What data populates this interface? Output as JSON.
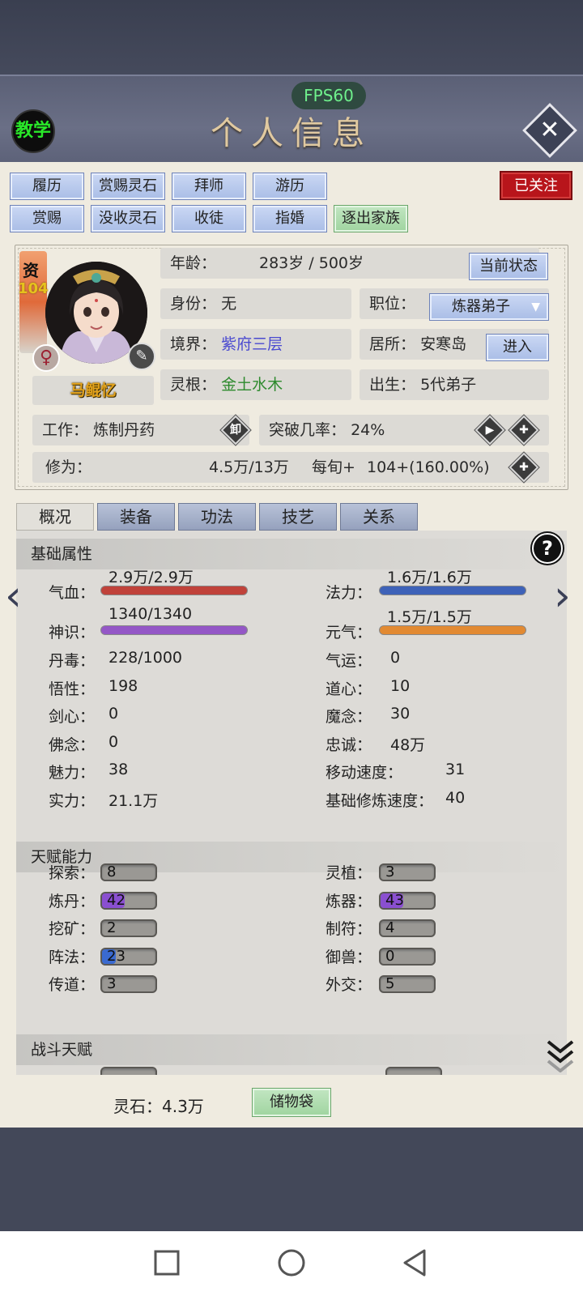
{
  "fps": "FPS60",
  "teach_label": "教学",
  "page_title": "个人信息",
  "action_buttons_row1": [
    "履历",
    "赏赐灵石",
    "拜师",
    "游历"
  ],
  "action_buttons_row2": [
    "赏赐",
    "没收灵石",
    "收徒",
    "指婚",
    "逐出家族"
  ],
  "followed_badge": "已关注",
  "profile": {
    "zi": "资",
    "zi_value": "104",
    "name": "马鲲忆",
    "sex_symbol": "♀",
    "age_label": "年龄：",
    "age_value": "283岁 / 500岁",
    "current_state_button": "当前状态",
    "identity_label": "身份：",
    "identity_value": "无",
    "position_label": "职位：",
    "position_value": "炼器弟子",
    "realm_label": "境界：",
    "realm_value": "紫府三层",
    "residence_label": "居所：",
    "residence_value": "安寒岛",
    "enter_button": "进入",
    "root_label": "灵根：",
    "root_value": "金土水木",
    "birth_label": "出生：",
    "birth_value": "5代弟子",
    "work_label": "工作：",
    "work_value": "炼制丹药",
    "work_badge": "卸",
    "breakthrough_label": "突破几率：",
    "breakthrough_value": "24%",
    "cultivation_label": "修为：",
    "cultivation_value": "4.5万/13万",
    "per_turn_label": "每旬+",
    "per_turn_value": "104+(160.00%)"
  },
  "tabs": [
    "概况",
    "装备",
    "功法",
    "技艺",
    "关系"
  ],
  "sections": {
    "basic": "基础属性",
    "talent": "天赋能力",
    "combat": "战斗天赋"
  },
  "bars": [
    {
      "label": "气血：",
      "text": "2.9万/2.9万",
      "fraction": 1.0,
      "color": "#c0423a"
    },
    {
      "label": "法力：",
      "text": "1.6万/1.6万",
      "fraction": 1.0,
      "color": "#3e62b8"
    },
    {
      "label": "神识：",
      "text": "1340/1340",
      "fraction": 1.0,
      "color": "#9457c6"
    },
    {
      "label": "元气：",
      "text": "1.5万/1.5万",
      "fraction": 1.0,
      "color": "#e28a32"
    }
  ],
  "attrs_left": [
    {
      "label": "丹毒：",
      "value": "228/1000"
    },
    {
      "label": "悟性：",
      "value": "198"
    },
    {
      "label": "剑心：",
      "value": "0"
    },
    {
      "label": "佛念：",
      "value": "0"
    },
    {
      "label": "魅力：",
      "value": "38"
    },
    {
      "label": "实力：",
      "value": "21.1万"
    }
  ],
  "attrs_right": [
    {
      "label": "气运：",
      "value": "0"
    },
    {
      "label": "道心：",
      "value": "10"
    },
    {
      "label": "魔念：",
      "value": "30"
    },
    {
      "label": "忠诚：",
      "value": "48万"
    },
    {
      "label": "移动速度：",
      "value": "31"
    },
    {
      "label": "基础修炼速度：",
      "value": "40"
    }
  ],
  "talents_left": [
    {
      "label": "探索：",
      "value": "8",
      "fraction": 0.0,
      "color": "#9a9894"
    },
    {
      "label": "炼丹：",
      "value": "42",
      "fraction": 0.42,
      "color": "#8a4fd0"
    },
    {
      "label": "挖矿：",
      "value": "2",
      "fraction": 0.0,
      "color": "#9a9894"
    },
    {
      "label": "阵法：",
      "value": "23",
      "fraction": 0.25,
      "color": "#3a6ad0"
    },
    {
      "label": "传道：",
      "value": "3",
      "fraction": 0.0,
      "color": "#9a9894"
    }
  ],
  "talents_right": [
    {
      "label": "灵植：",
      "value": "3",
      "fraction": 0.0,
      "color": "#9a9894"
    },
    {
      "label": "炼器：",
      "value": "43",
      "fraction": 0.43,
      "color": "#8a4fd0"
    },
    {
      "label": "制符：",
      "value": "4",
      "fraction": 0.0,
      "color": "#9a9894"
    },
    {
      "label": "御兽：",
      "value": "0",
      "fraction": 0.0,
      "color": "#9a9894"
    },
    {
      "label": "外交：",
      "value": "5",
      "fraction": 0.0,
      "color": "#9a9894"
    }
  ],
  "footer": {
    "spirit_stone": "灵石：4.3万",
    "bag_button": "储物袋"
  },
  "help_symbol": "?",
  "chevron_left": "‹",
  "chevron_right": "›",
  "icons": [
    "close-icon",
    "female-icon",
    "brush-icon",
    "play-icon",
    "plus-icon",
    "help-icon",
    "double-chevron-down-icon",
    "square-icon",
    "circle-icon",
    "triangle-back-icon"
  ]
}
